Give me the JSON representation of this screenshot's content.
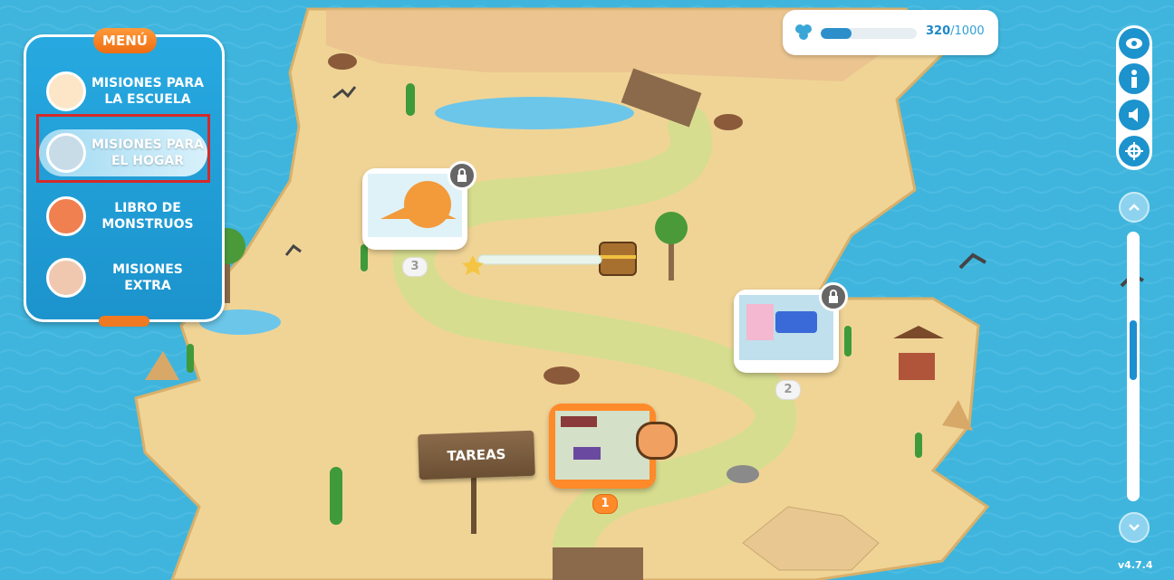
{
  "menu": {
    "title": "MENÚ",
    "items": [
      {
        "label": "MISIONES PARA\nLA ESCUELA",
        "icon": "school-map-icon"
      },
      {
        "label": "MISIONES PARA\nEL HOGAR",
        "icon": "compass-icon"
      },
      {
        "label": "LIBRO DE\nMONSTRUOS",
        "icon": "monster-book-icon"
      },
      {
        "label": "MISIONES\nEXTRA",
        "icon": "feather-scroll-icon"
      }
    ],
    "active_index": 1
  },
  "progress": {
    "current": "320",
    "max": "/1000",
    "fill_fraction": 0.32,
    "icon": "clover-icon"
  },
  "controls": {
    "buttons": [
      "eye-icon",
      "info-icon",
      "sound-icon",
      "location-icon"
    ],
    "scroll_up": "chevron-up-icon",
    "scroll_down": "chevron-down-icon",
    "version": "v4.7.4"
  },
  "map": {
    "sign_label": "TAREAS",
    "missions": [
      {
        "number": "1",
        "locked": false,
        "state": "current"
      },
      {
        "number": "2",
        "locked": true,
        "state": "locked"
      },
      {
        "number": "3",
        "locked": true,
        "state": "locked"
      }
    ]
  },
  "colors": {
    "ocean": "#3fb5dd",
    "sand": "#f0d496",
    "path": "#d7dd8f",
    "menu_blue": "#1c93cd",
    "accent_orange": "#ef7a22",
    "highlight_red": "#d42a2a"
  }
}
